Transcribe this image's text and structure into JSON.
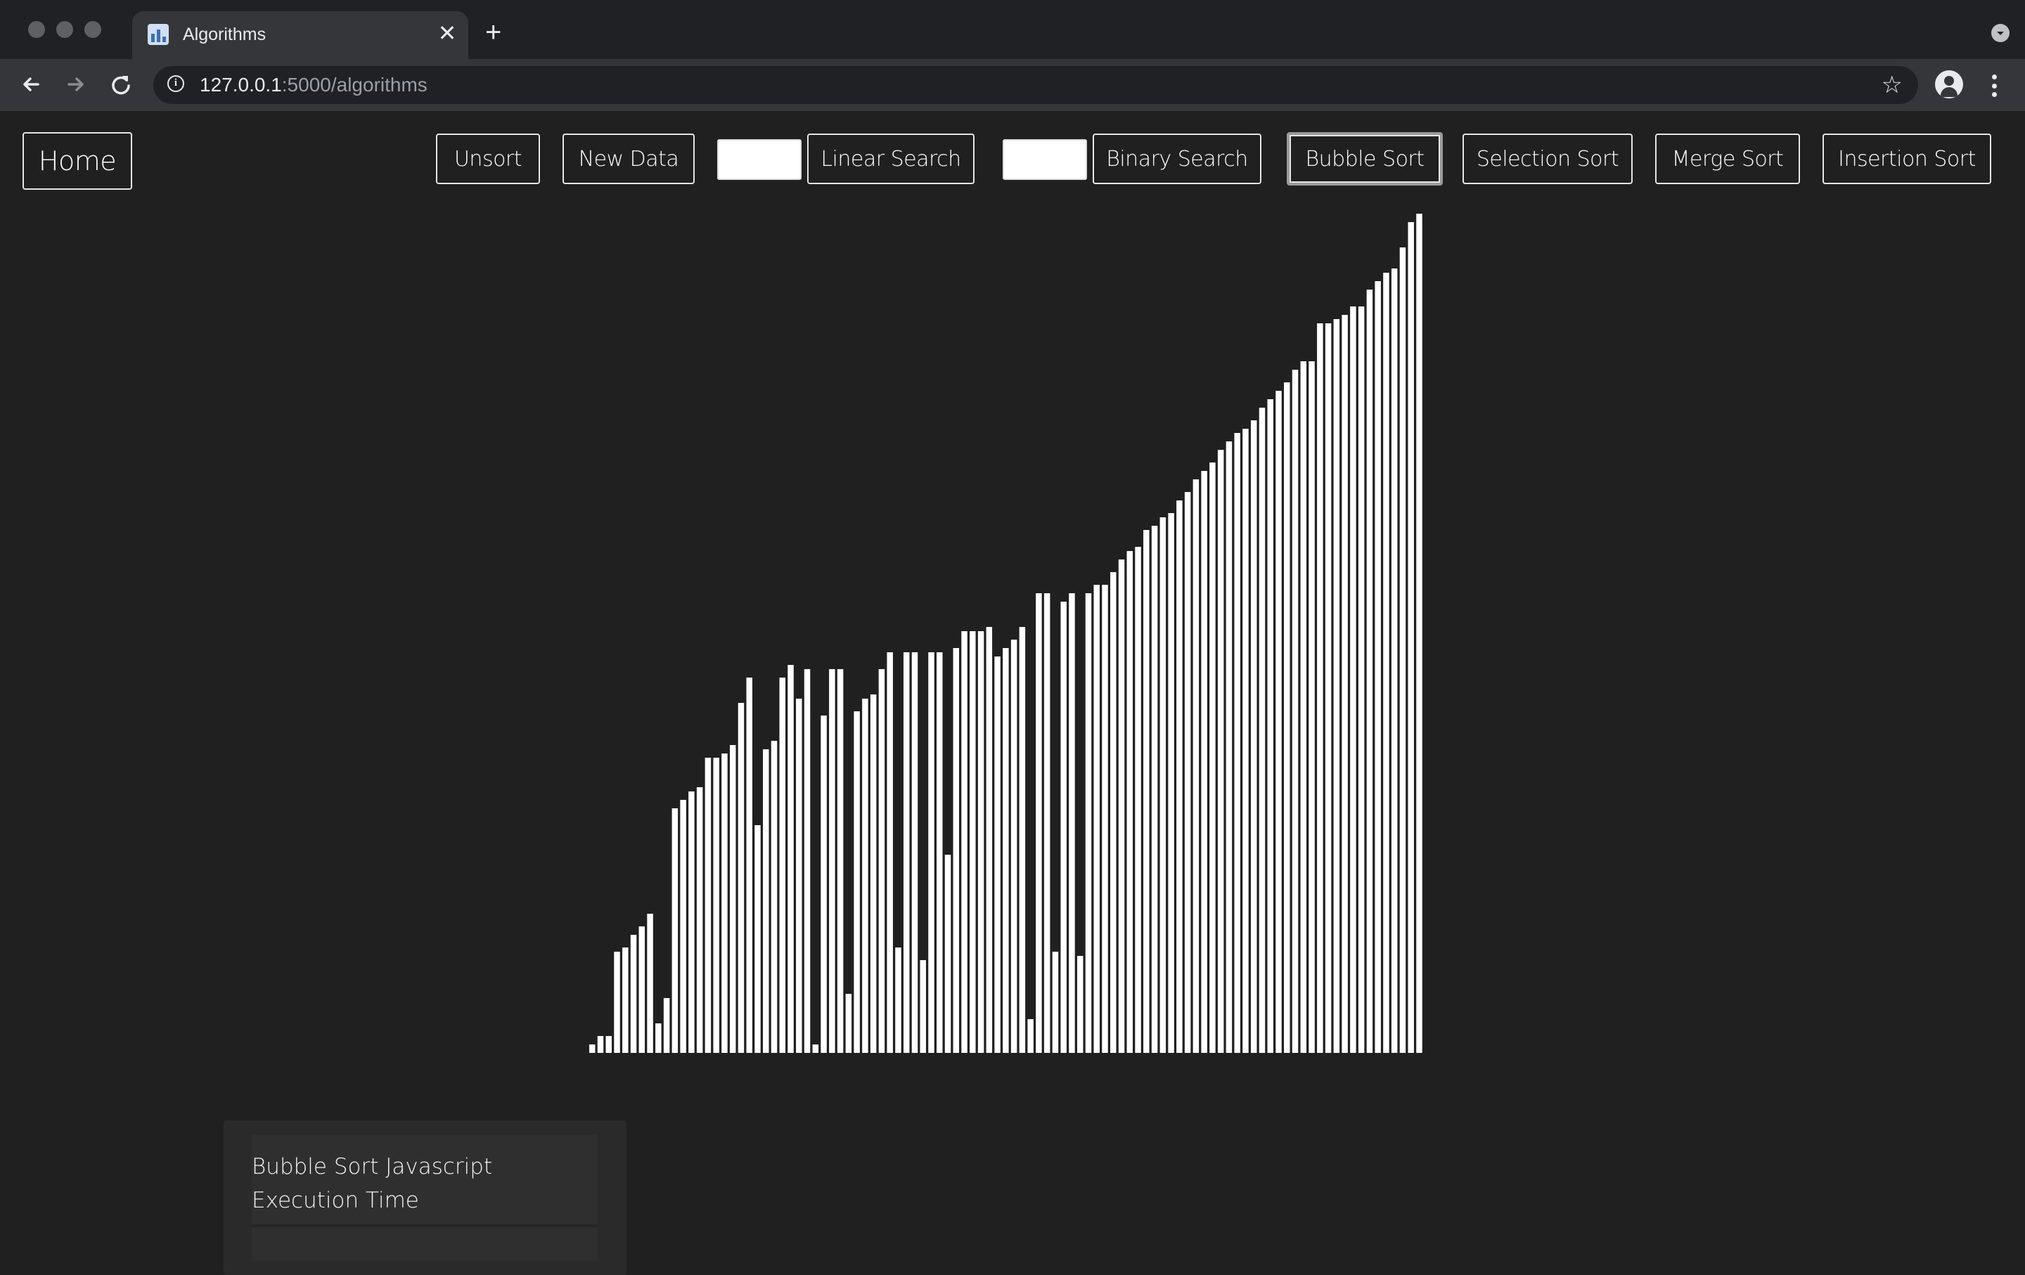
{
  "browser": {
    "tab": {
      "title": "Algorithms",
      "favicon": "bar-chart-favicon-icon"
    },
    "new_tab_label": "+",
    "close_glyph": "✕",
    "url": {
      "host": "127.0.0.1",
      "rest": ":5000/algorithms"
    }
  },
  "navbar": {
    "home_label": "Home",
    "unsort_label": "Unsort",
    "new_data_label": "New Data",
    "linear_search": {
      "value": "",
      "label": "Linear Search"
    },
    "binary_search": {
      "value": "",
      "label": "Binary Search"
    },
    "bubble_sort_label": "Bubble Sort",
    "selection_sort_label": "Selection Sort",
    "merge_sort_label": "Merge Sort",
    "insertion_sort_label": "Insertion Sort",
    "active_algorithm": "Bubble Sort"
  },
  "chart_data": {
    "type": "bar",
    "bar_color": "#ffffff",
    "ylim": [
      0,
      100
    ],
    "values": [
      1,
      2,
      2,
      12,
      12.5,
      14,
      15,
      16.5,
      3.5,
      6.5,
      29,
      30,
      31,
      31.5,
      35,
      35,
      35.5,
      36.5,
      41.5,
      44.5,
      27,
      36,
      37,
      44.5,
      46,
      42,
      45.5,
      1,
      40,
      45.5,
      45.5,
      7,
      40.5,
      42,
      42.5,
      45.5,
      47.5,
      12.5,
      47.5,
      47.5,
      11,
      47.5,
      47.5,
      23.5,
      48,
      50,
      50,
      50,
      50.5,
      47,
      48,
      49,
      50.5,
      4,
      54.5,
      54.5,
      12,
      53.5,
      54.5,
      11.5,
      54.5,
      55.5,
      55.5,
      57,
      58.5,
      59.5,
      60,
      62,
      62.5,
      63.5,
      64,
      65.5,
      66.5,
      68,
      69,
      70,
      71.5,
      72.5,
      73.5,
      74,
      75,
      76.5,
      77.5,
      78.5,
      79.5,
      81,
      82,
      82,
      86.5,
      86.5,
      87,
      87.5,
      88.5,
      88.5,
      90.5,
      91.5,
      92.5,
      93,
      95.5,
      98.5,
      99.5
    ]
  },
  "result_card": {
    "title": "Bubble Sort Javascript Execution Time"
  },
  "icons": {
    "back": "back-arrow-icon",
    "forward": "forward-arrow-icon",
    "reload": "reload-icon",
    "info": "info-icon",
    "star": "bookmark-star-icon",
    "profile": "profile-icon",
    "menu": "kebab-menu-icon",
    "tab_search": "tab-search-icon"
  }
}
